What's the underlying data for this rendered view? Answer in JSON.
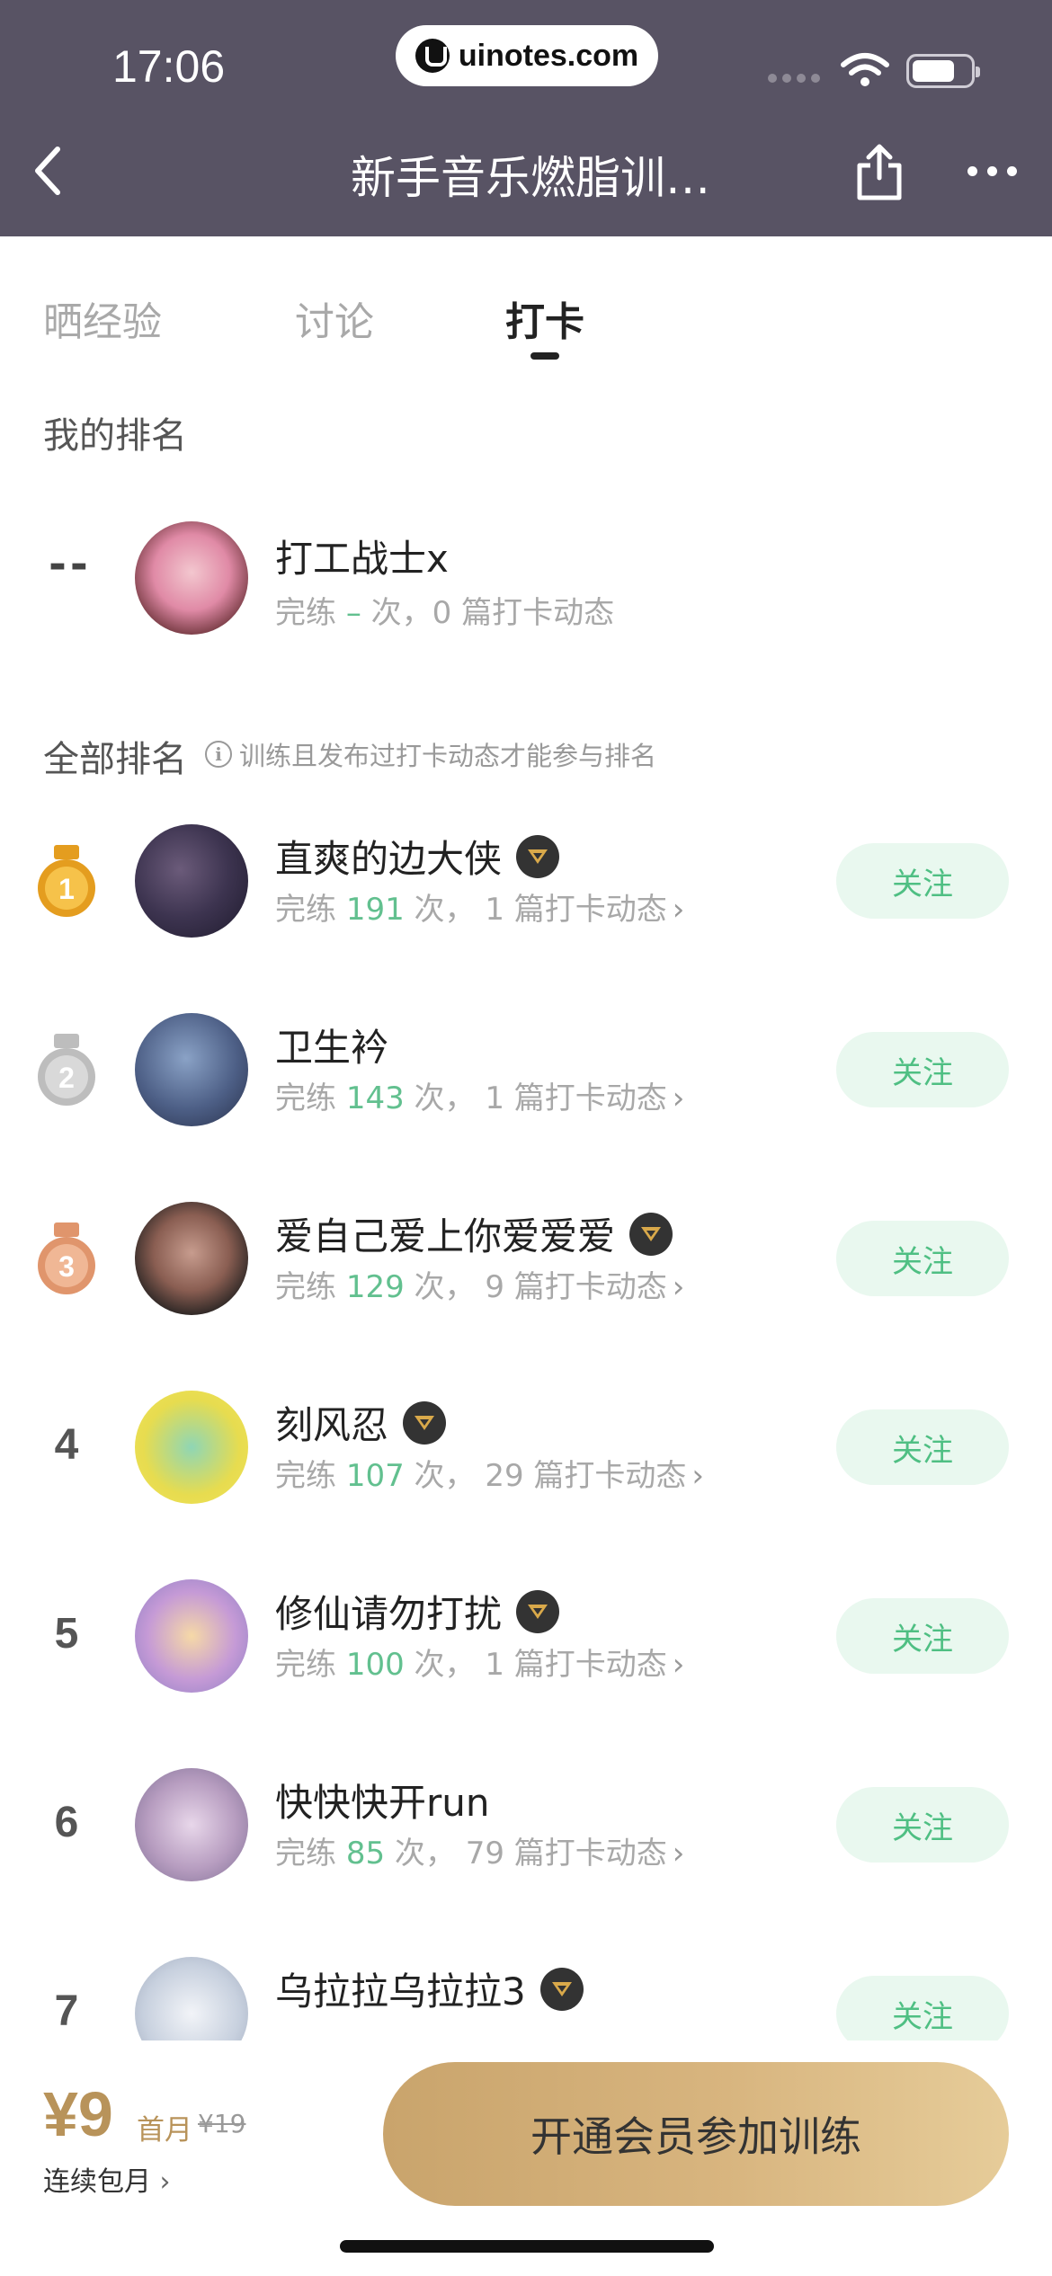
{
  "status_bar": {
    "time": "17:06",
    "url": "uinotes.com"
  },
  "nav": {
    "title": "新手音乐燃脂训…"
  },
  "tabs": [
    {
      "label": "晒经验",
      "active": false
    },
    {
      "label": "讨论",
      "active": false
    },
    {
      "label": "打卡",
      "active": true
    }
  ],
  "my_ranking": {
    "section_label": "我的排名",
    "rank": "--",
    "name": "打工战士x",
    "stats_prefix": "完练",
    "count": "–",
    "stats_mid": "次，0 篇打卡动态"
  },
  "all_ranking": {
    "section_label": "全部排名",
    "hint": "训练且发布过打卡动态才能参与排名",
    "follow_label": "关注",
    "rows": [
      {
        "rank": "1",
        "medal": "gold",
        "name": "直爽的边大侠",
        "vip": true,
        "count": "191",
        "posts": "1"
      },
      {
        "rank": "2",
        "medal": "silver",
        "name": "卫生衿",
        "vip": false,
        "count": "143",
        "posts": "1"
      },
      {
        "rank": "3",
        "medal": "bronze",
        "name": "爱自己爱上你爱爱爱",
        "vip": true,
        "count": "129",
        "posts": "9"
      },
      {
        "rank": "4",
        "medal": "",
        "name": "刻风忍",
        "vip": true,
        "count": "107",
        "posts": "29"
      },
      {
        "rank": "5",
        "medal": "",
        "name": "修仙请勿打扰",
        "vip": true,
        "count": "100",
        "posts": "1"
      },
      {
        "rank": "6",
        "medal": "",
        "name": "快快快开run",
        "vip": false,
        "count": "85",
        "posts": "79"
      },
      {
        "rank": "7",
        "medal": "",
        "name": "乌拉拉乌拉拉3",
        "vip": true,
        "count": "",
        "posts": ""
      }
    ],
    "stats_prefix": "完练",
    "times_suffix": "次，",
    "posts_suffix": "篇打卡动态"
  },
  "bottom": {
    "price": "¥9",
    "first_month": "首月",
    "old_price": "¥19",
    "monthly": "连续包月",
    "cta": "开通会员参加训练"
  },
  "colors": {
    "nav_bg": "#585364",
    "accent_green": "#4fbf83",
    "gold": "#b8935a"
  }
}
